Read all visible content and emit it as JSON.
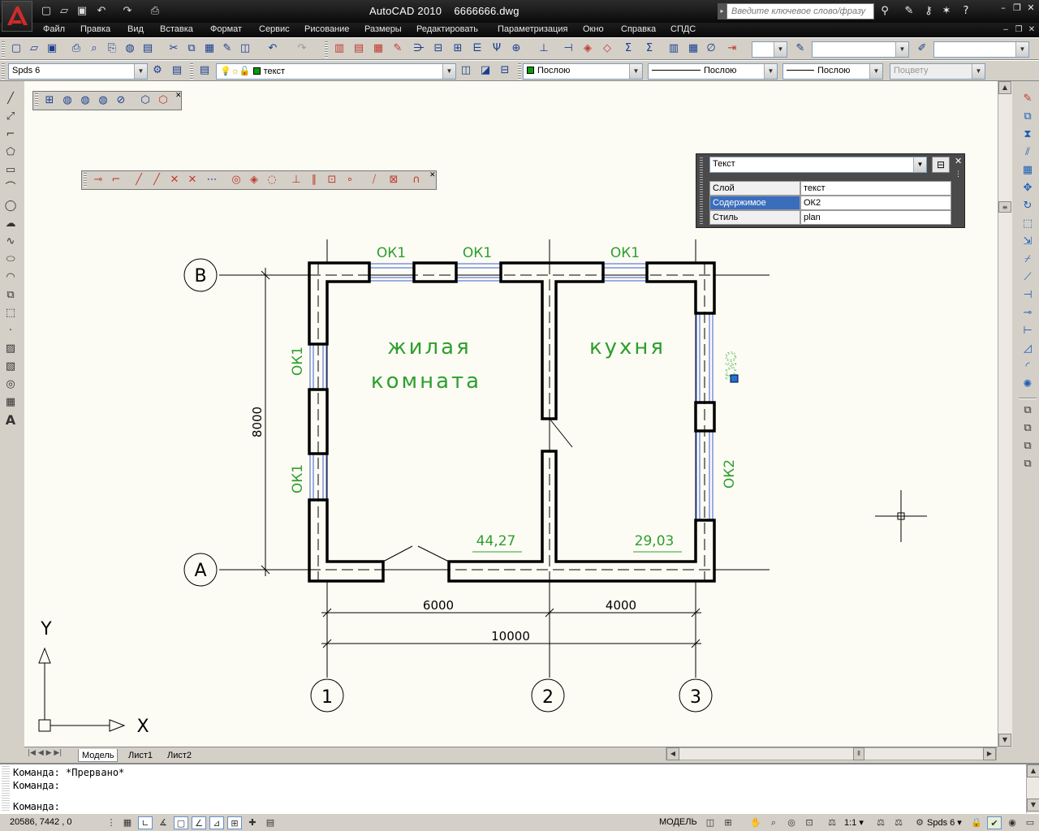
{
  "title": {
    "app": "AutoCAD 2010",
    "file": "6666666.dwg",
    "search_placeholder": "Введите ключевое слово/фразу"
  },
  "menu": [
    "Файл",
    "Правка",
    "Вид",
    "Вставка",
    "Формат",
    "Сервис",
    "Рисование",
    "Размеры",
    "Редактировать",
    "Параметризация",
    "Окно",
    "Справка",
    "СПДС"
  ],
  "toolbars": {
    "style_combo": "Spds 6",
    "layer_combo": "текст",
    "color_combo": "Послою",
    "linetype_combo": "Послою",
    "lineweight_combo": "Послою",
    "plotstyle_combo": "Поцвету"
  },
  "quick_props": {
    "type": "Текст",
    "rows": [
      {
        "key": "Слой",
        "value": "текст"
      },
      {
        "key": "Содержимое",
        "value": "ОК2"
      },
      {
        "key": "Стиль",
        "value": "plan"
      }
    ]
  },
  "drawing": {
    "axis_letters": [
      "В",
      "А"
    ],
    "axis_numbers": [
      "1",
      "2",
      "3"
    ],
    "room_living_line1": "жилая",
    "room_living_line2": "комната",
    "room_kitchen": "кухня",
    "area_living": "44,27",
    "area_kitchen": "29,03",
    "window_labels_top": [
      "ОК1",
      "ОК1",
      "ОК1"
    ],
    "window_labels_left": [
      "ОК1",
      "ОК1"
    ],
    "window_labels_right": [
      "ОК2",
      "ОК2"
    ],
    "dim_6000": "6000",
    "dim_4000": "4000",
    "dim_10000": "10000",
    "dim_8000": "8000",
    "ucs_x": "X",
    "ucs_y": "Y"
  },
  "tabs": [
    "Модель",
    "Лист1",
    "Лист2"
  ],
  "command_lines": [
    "Команда: *Прервано*",
    "Команда:",
    "Команда:"
  ],
  "status": {
    "coords": "20586, 7442 , 0",
    "model": "МОДЕЛЬ",
    "scale": "1:1",
    "anno_style": "Spds 6"
  },
  "colors": {
    "drawing_green": "#2e9e2e",
    "wall": "#000000",
    "window_blue": "#3b5bd6",
    "canvas_bg": "#fcfcf4"
  }
}
